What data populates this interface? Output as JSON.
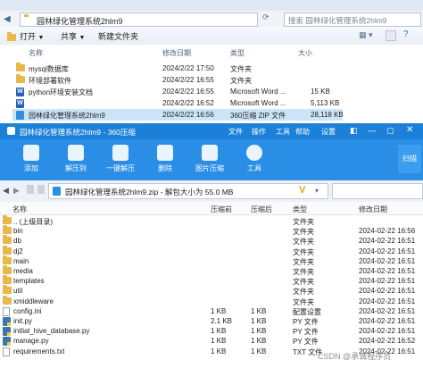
{
  "explorer": {
    "title": "园林绿化管理系统2hlm9",
    "address": "园林绿化管理系统2hlm9",
    "search_placeholder": "搜索 园林绿化管理系统2hlm9",
    "toolbar": {
      "open": "打开",
      "share": "共享",
      "new_folder": "新建文件夹"
    },
    "columns": {
      "name": "名称",
      "date": "修改日期",
      "type": "类型",
      "size": "大小"
    },
    "rows": [
      {
        "name": "mysql数据库",
        "date": "2024/2/22 17:50",
        "type": "文件夹",
        "size": "",
        "icon": "folder"
      },
      {
        "name": "环境部署软件",
        "date": "2024/2/22 16:55",
        "type": "文件夹",
        "size": "",
        "icon": "folder"
      },
      {
        "name": "python环境安装文档",
        "date": "2024/2/22 16:55",
        "type": "Microsoft Word ...",
        "size": "15 KB",
        "icon": "word"
      },
      {
        "name": "",
        "date": "2024/2/22 16:52",
        "type": "Microsoft Word ...",
        "size": "5,113 KB",
        "icon": "word"
      },
      {
        "name": "园林绿化管理系统2hlm9",
        "date": "2024/2/22 16:56",
        "type": "360压缩 ZIP 文件",
        "size": "28,118 KB",
        "icon": "zip"
      }
    ]
  },
  "zip": {
    "title": "园林绿化管理系统2hlm9 - 360压缩",
    "menu": {
      "file": "文件",
      "ops": "操作",
      "tools": "工具",
      "help": "帮助",
      "settings": "设置"
    },
    "scan": "扫描",
    "tools": [
      {
        "label": "添加",
        "icon": "add-icon"
      },
      {
        "label": "解压到",
        "icon": "extract-to-icon"
      },
      {
        "label": "一键解压",
        "icon": "one-click-extract-icon"
      },
      {
        "label": "删除",
        "icon": "delete-icon"
      },
      {
        "label": "图片压缩",
        "icon": "image-compress-icon"
      },
      {
        "label": "工具",
        "icon": "tools-icon"
      }
    ],
    "path": "园林绿化管理系统2hlm9.zip - 解包大小为 55.0 MB",
    "columns": {
      "name": "名称",
      "compressed": "压缩前",
      "uncompressed": "压缩后",
      "type": "类型",
      "date": "修改日期"
    },
    "rows": [
      {
        "name": ".. (上级目录)",
        "c": "",
        "u": "",
        "type": "文件夹",
        "date": "",
        "icon": "folder"
      },
      {
        "name": "bin",
        "c": "",
        "u": "",
        "type": "文件夹",
        "date": "2024-02-22 16:56",
        "icon": "folder"
      },
      {
        "name": "db",
        "c": "",
        "u": "",
        "type": "文件夹",
        "date": "2024-02-22 16:51",
        "icon": "folder"
      },
      {
        "name": "dj2",
        "c": "",
        "u": "",
        "type": "文件夹",
        "date": "2024-02-22 16:51",
        "icon": "folder"
      },
      {
        "name": "main",
        "c": "",
        "u": "",
        "type": "文件夹",
        "date": "2024-02-22 16:51",
        "icon": "folder"
      },
      {
        "name": "media",
        "c": "",
        "u": "",
        "type": "文件夹",
        "date": "2024-02-22 16:51",
        "icon": "folder"
      },
      {
        "name": "templates",
        "c": "",
        "u": "",
        "type": "文件夹",
        "date": "2024-02-22 16:51",
        "icon": "folder"
      },
      {
        "name": "util",
        "c": "",
        "u": "",
        "type": "文件夹",
        "date": "2024-02-22 16:51",
        "icon": "folder"
      },
      {
        "name": "xmiddleware",
        "c": "",
        "u": "",
        "type": "文件夹",
        "date": "2024-02-22 16:51",
        "icon": "folder"
      },
      {
        "name": "config.ini",
        "c": "1 KB",
        "u": "1 KB",
        "type": "配置设置",
        "date": "2024-02-22 16:51",
        "icon": "file"
      },
      {
        "name": "init.py",
        "c": "2.1 KB",
        "u": "1 KB",
        "type": "PY 文件",
        "date": "2024-02-22 16:51",
        "icon": "py"
      },
      {
        "name": "initial_hive_database.py",
        "c": "1 KB",
        "u": "1 KB",
        "type": "PY 文件",
        "date": "2024-02-22 16:51",
        "icon": "py"
      },
      {
        "name": "manage.py",
        "c": "1 KB",
        "u": "1 KB",
        "type": "PY 文件",
        "date": "2024-02-22 16:52",
        "icon": "py"
      },
      {
        "name": "requirements.txt",
        "c": "1 KB",
        "u": "1 KB",
        "type": "TXT 文件",
        "date": "2024-02-22 16:51",
        "icon": "file"
      }
    ],
    "watermark": "CSDN @承诚程序员"
  }
}
